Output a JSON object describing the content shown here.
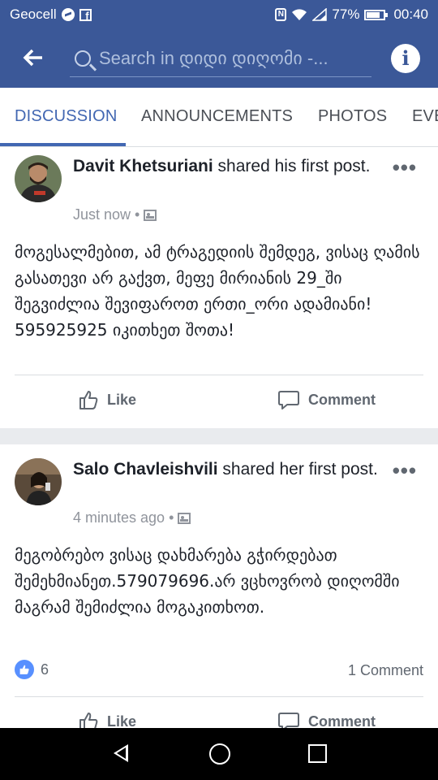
{
  "status_bar": {
    "carrier": "Geocell",
    "battery": "77%",
    "time": "00:40"
  },
  "search": {
    "placeholder": "Search in დიდი დიღომი -..."
  },
  "tabs": [
    {
      "label": "DISCUSSION",
      "active": true
    },
    {
      "label": "ANNOUNCEMENTS",
      "active": false
    },
    {
      "label": "PHOTOS",
      "active": false
    },
    {
      "label": "EVE",
      "active": false
    }
  ],
  "posts": [
    {
      "author": "Davit Khetsuriani",
      "action": " shared his first post.",
      "time": "Just now",
      "text": "მოგესალმებით, ამ ტრაგედიის შემდეგ, ვისაც ღამის გასათევი არ გაქვთ, მეფე მირიანის 29_ში შეგვიძლია შევიფაროთ ერთი_ორი ადამიანი! 595925925 იკითხეთ შოთა!",
      "like_label": "Like",
      "comment_label": "Comment"
    },
    {
      "author": "Salo Chavleishvili",
      "action": " shared her first post.",
      "time": "4 minutes ago",
      "text": "მეგობრებო ვისაც დახმარება გჭირდებათ შემეხმიანეთ.579079696.არ ვცხოვრობ დიღომში მაგრამ შემიძლია მოგაკითხოთ.",
      "reactions": "6",
      "comments": "1 Comment",
      "like_label": "Like",
      "comment_label": "Comment"
    }
  ],
  "colors": {
    "brand": "#3b5898",
    "tab_active": "#4267b2",
    "like_badge": "#5890ff"
  }
}
